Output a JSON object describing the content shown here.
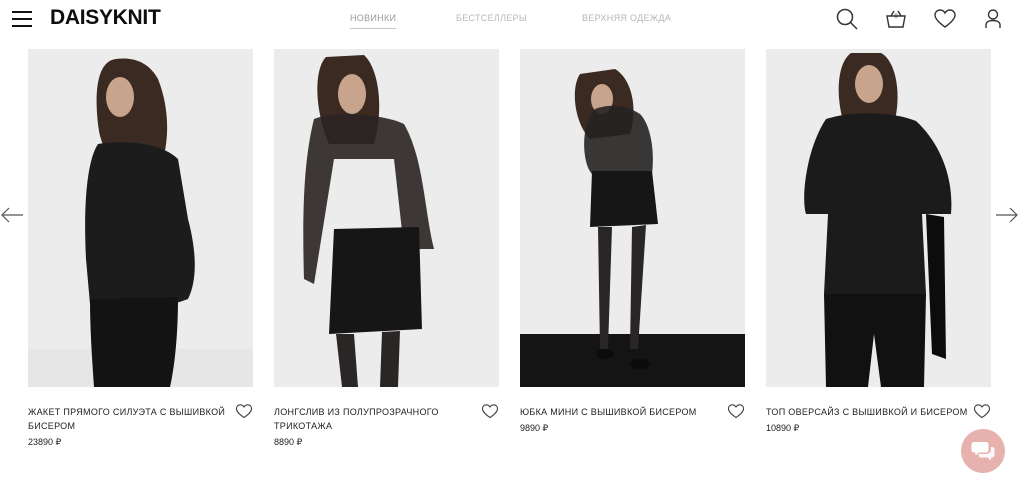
{
  "header": {
    "logo": "DAISYKNIT",
    "nav": [
      {
        "label": "НОВИНКИ",
        "active": true
      },
      {
        "label": "БЕСТСЕЛЛЕРЫ",
        "active": false
      },
      {
        "label": "ВЕРХНЯЯ ОДЕЖДА",
        "active": false
      }
    ],
    "cart_count": "0",
    "icons": [
      "menu-icon",
      "search-icon",
      "basket-icon",
      "heart-icon",
      "user-icon"
    ]
  },
  "carousel": {
    "prev_icon": "arrow-left-icon",
    "next_icon": "arrow-right-icon"
  },
  "products": [
    {
      "name": "ЖАКЕТ ПРЯМОГО СИЛУЭТА С ВЫШИВКОЙ БИСЕРОМ",
      "price": "23890 ₽"
    },
    {
      "name": "ЛОНГСЛИВ ИЗ ПОЛУПРОЗРАЧНОГО ТРИКОТАЖА",
      "price": "8890 ₽"
    },
    {
      "name": "ЮБКА МИНИ С ВЫШИВКОЙ БИСЕРОМ",
      "price": "9890 ₽"
    },
    {
      "name": "ТОП ОВЕРСАЙЗ С ВЫШИВКОЙ И БИСЕРОМ",
      "price": "10890 ₽"
    }
  ],
  "chat": {
    "icon": "chat-icon"
  },
  "colors": {
    "accent": "#e7b1ad",
    "nav_text": "#b7b7b7",
    "photo_bg": "#ececec"
  }
}
